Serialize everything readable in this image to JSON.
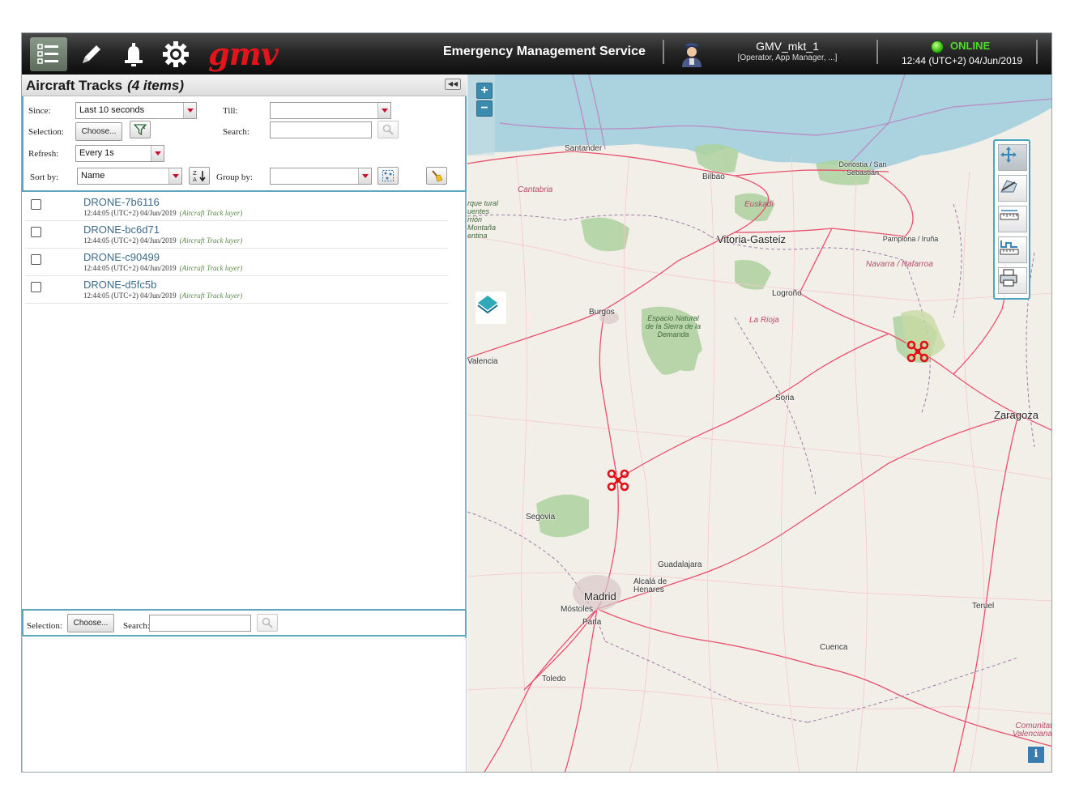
{
  "header": {
    "logo_text": "gmv",
    "app_title": "Emergency Management Service",
    "user_name": "GMV_mkt_1",
    "user_roles": "[Operator, App Manager, ...]",
    "status": "ONLINE",
    "clock": "12:44 (UTC+2) 04/Jun/2019",
    "icons": [
      "list-icon",
      "pencil-icon",
      "bell-icon",
      "gear-icon",
      "user-avatar-icon",
      "status-led-icon"
    ]
  },
  "panel": {
    "title": "Aircraft Tracks",
    "count": "(4 items)"
  },
  "filters": {
    "since_label": "Since:",
    "since_value": "Last 10 seconds",
    "till_label": "Till:",
    "till_value": "",
    "selection_label": "Selection:",
    "choose_label": "Choose...",
    "search_label": "Search:",
    "search_value": "",
    "refresh_label": "Refresh:",
    "refresh_value": "Every 1s",
    "sortby_label": "Sort by:",
    "sortby_value": "Name",
    "groupby_label": "Group by:",
    "groupby_value": ""
  },
  "tracks": [
    {
      "name": "DRONE-7b6116",
      "time": "12:44:05 (UTC+2) 04/Jun/2019",
      "layer": "(Aircraft Track layer)"
    },
    {
      "name": "DRONE-bc6d71",
      "time": "12:44:05 (UTC+2) 04/Jun/2019",
      "layer": "(Aircraft Track layer)"
    },
    {
      "name": "DRONE-c90499",
      "time": "12:44:05 (UTC+2) 04/Jun/2019",
      "layer": "(Aircraft Track layer)"
    },
    {
      "name": "DRONE-d5fc5b",
      "time": "12:44:05 (UTC+2) 04/Jun/2019",
      "layer": "(Aircraft Track layer)"
    }
  ],
  "lower_filter": {
    "selection_label": "Selection:",
    "choose_label": "Choose...",
    "search_label": "Search:",
    "search_value": ""
  },
  "map": {
    "zoom_in": "+",
    "zoom_out": "−",
    "info": "i",
    "cities": [
      "Santander",
      "Bilbao",
      "Donostia / San Sebastián",
      "Vitoria-Gasteiz",
      "Pamplona / Iruña",
      "Logroño",
      "Burgos",
      "Soria",
      "Zaragoza",
      "Segovia",
      "Guadalajara",
      "Alcalá de Henares",
      "Madrid",
      "Móstoles",
      "Parla",
      "Cuenca",
      "Teruel",
      "Toledo",
      "Valencia"
    ],
    "regions": [
      "Cantabria",
      "Euskadi",
      "Navarra / Nafarroa",
      "La Rioja",
      "Comunitat Valenciana"
    ],
    "parks": [
      "Espacio Natural de la Sierra de la Demanda",
      "rque tural uentes rrión Montaña entina"
    ],
    "tools": [
      "pan-tool-icon",
      "measure-area-icon",
      "ruler-icon",
      "measure-profile-icon",
      "print-icon"
    ],
    "colors": {
      "sea": "#aad3df",
      "land": "#f2efe9",
      "roads": "#e8506e",
      "forest": "#add19e",
      "drone": "#e0101a"
    }
  }
}
